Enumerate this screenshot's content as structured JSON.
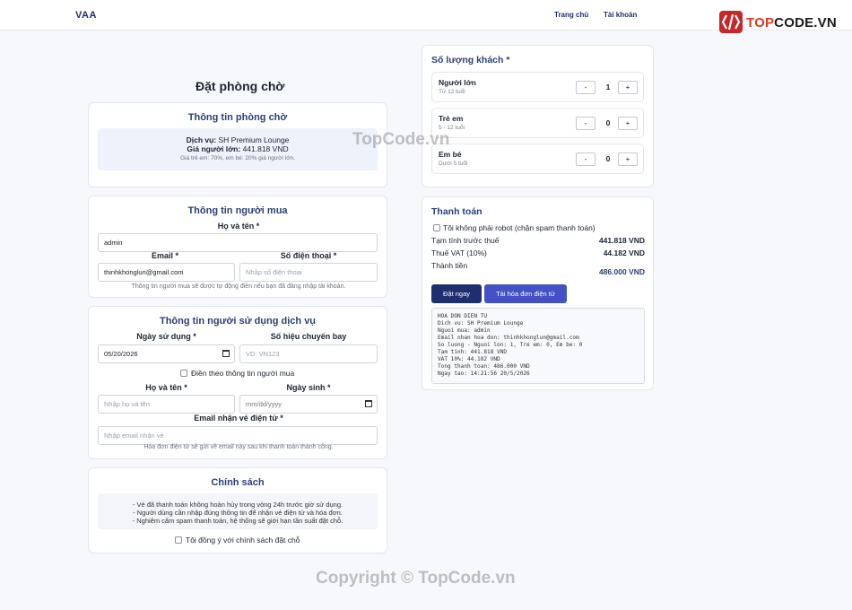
{
  "header": {
    "brand": "VAA",
    "nav": [
      {
        "label": "Trang chủ"
      },
      {
        "label": "Tài khoản"
      }
    ],
    "logo": {
      "prefix": "TOP",
      "suffix": "CODE.VN"
    }
  },
  "page_title": "Đặt phòng chờ",
  "lounge_info": {
    "title": "Thông tin phòng chờ",
    "service_label": "Dịch vụ:",
    "service_value": "SH Premium Lounge",
    "price_label": "Giá người lớn:",
    "price_value": "441.818 VND",
    "note": "Giá trẻ em: 70%, em bé: 20% giá người lớn."
  },
  "buyer": {
    "title": "Thông tin người mua",
    "name_label": "Họ và tên *",
    "name_value": "admin",
    "email_label": "Email *",
    "email_value": "thinhkhonglun@gmail.com",
    "phone_label": "Số điện thoại *",
    "phone_placeholder": "Nhập số điện thoại",
    "hint": "Thông tin người mua sẽ được tự động điền nếu bạn đã đăng nhập tài khoản."
  },
  "user": {
    "title": "Thông tin người sử dụng dịch vụ",
    "date_label": "Ngày sử dụng *",
    "date_value": "05/20/2026",
    "flight_label": "Số hiệu chuyến bay",
    "flight_placeholder": "VD: VN123",
    "same_as_buyer": "Điền theo thông tin người mua",
    "name_label": "Họ và tên *",
    "name_placeholder": "Nhập họ và tên",
    "dob_label": "Ngày sinh *",
    "dob_placeholder": "mm/dd/yyyy",
    "email_label": "Email nhận vé điện tử *",
    "email_placeholder": "Nhập email nhận vé",
    "hint": "Hóa đơn điện tử sẽ gửi về email này sau khi thanh toán thành công."
  },
  "policy": {
    "title": "Chính sách",
    "lines": [
      "- Vé đã thanh toán không hoàn hủy trong vòng 24h trước giờ sử dụng.",
      "- Người dùng cần nhập đúng thông tin để nhận vé điện tử và hóa đơn.",
      "- Nghiêm cấm spam thanh toán, hệ thống sẽ giới hạn tần suất đặt chỗ."
    ],
    "agree": "Tôi đồng ý với chính sách đặt chỗ"
  },
  "guests": {
    "title": "Số lượng khách *",
    "rows": [
      {
        "name": "Người lớn",
        "sub": "Từ 12 tuổi",
        "count": "1"
      },
      {
        "name": "Trẻ em",
        "sub": "5 - 12 tuổi",
        "count": "0"
      },
      {
        "name": "Em bé",
        "sub": "Dưới 5 tuổi",
        "count": "0"
      }
    ],
    "minus": "-",
    "plus": "+"
  },
  "payment": {
    "title": "Thanh toán",
    "robot": "Tôi không phải robot (chặn spam thanh toán)",
    "subtotal_label": "Tạm tính trước thuế",
    "subtotal_value": "441.818 VND",
    "vat_label": "Thuế VAT (10%)",
    "vat_value": "44.182 VND",
    "total_label": "Thành tiền",
    "total_value": "486.000 VND",
    "book_button": "Đặt ngay",
    "invoice_button": "Tải hóa đơn điện tử",
    "invoice_lines": [
      "HOA DON DIEN TU",
      "Dich vu: SH Premium Lounge",
      "Nguoi mua: admin",
      "Email nhan hoa don: thinhkhonglun@gmail.com",
      "So luong - Nguoi lon: 1, Tre em: 0, Em be: 0",
      "Tam tinh: 441.818 VND",
      "VAT 10%: 44.182 VND",
      "Tong thanh toan: 486.000 VND",
      "Ngay tao: 14:21:56 20/5/2026"
    ]
  },
  "watermarks": {
    "mid": "TopCode.vn",
    "footer": "Copyright © TopCode.vn"
  },
  "colors": {
    "primary": "#1f2e6e",
    "secondary_button": "#4351c4",
    "accent": "#2b3f78"
  }
}
